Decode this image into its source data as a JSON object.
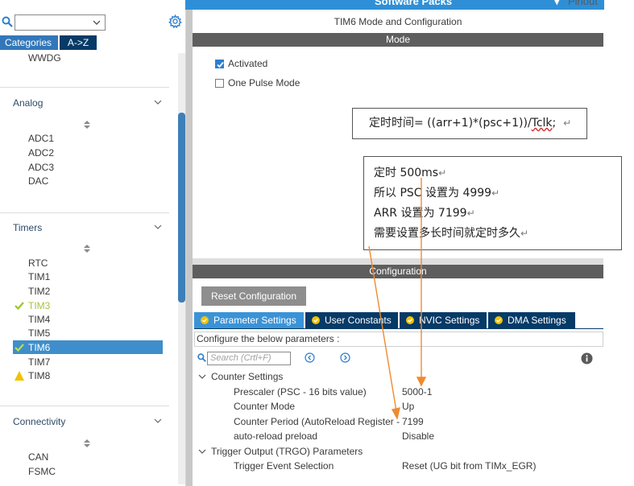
{
  "topbar": {
    "software_packs": "Software Packs",
    "pinout_arrow": "▾",
    "pinout": "Pinout"
  },
  "left_panel": {
    "tabs": {
      "categories": "Categories",
      "az": "A->Z"
    },
    "system_core_items": [
      "WWDG"
    ],
    "analog": {
      "header": "Analog",
      "items": [
        "ADC1",
        "ADC2",
        "ADC3",
        "DAC"
      ]
    },
    "timers": {
      "header": "Timers",
      "items": [
        {
          "label": "RTC",
          "status": "none"
        },
        {
          "label": "TIM1",
          "status": "none"
        },
        {
          "label": "TIM2",
          "status": "none"
        },
        {
          "label": "TIM3",
          "status": "configured"
        },
        {
          "label": "TIM4",
          "status": "none"
        },
        {
          "label": "TIM5",
          "status": "none"
        },
        {
          "label": "TIM6",
          "status": "selected"
        },
        {
          "label": "TIM7",
          "status": "none"
        },
        {
          "label": "TIM8",
          "status": "warning"
        }
      ]
    },
    "connectivity": {
      "header": "Connectivity",
      "items": [
        "CAN",
        "FSMC"
      ]
    }
  },
  "right_panel": {
    "title": "TIM6 Mode and Configuration",
    "mode_header": "Mode",
    "activated": {
      "label": "Activated",
      "checked": true
    },
    "one_pulse": {
      "label": "One Pulse Mode",
      "checked": false
    },
    "config_header": "Configuration",
    "reset_button": "Reset Configuration",
    "tabs": [
      "Parameter Settings",
      "User Constants",
      "NVIC Settings",
      "DMA Settings"
    ],
    "active_tab": "Parameter Settings",
    "configure_label": "Configure the below parameters :",
    "search_placeholder": "Search (Crtl+F)",
    "groups": {
      "counter_settings": {
        "label": "Counter Settings",
        "params": [
          {
            "name": "Prescaler (PSC - 16 bits value)",
            "value": "5000-1"
          },
          {
            "name": "Counter Mode",
            "value": "Up"
          },
          {
            "name": "Counter Period (AutoReload Register - ...",
            "value": "7199"
          },
          {
            "name": "auto-reload preload",
            "value": "Disable"
          }
        ]
      },
      "trigger_output": {
        "label": "Trigger Output (TRGO) Parameters",
        "params": [
          {
            "name": "Trigger Event Selection",
            "value": "Reset (UG bit from TIMx_EGR)"
          }
        ]
      }
    }
  },
  "annotations": {
    "formula": {
      "prefix": "定时时间= ((arr+1)*(psc+1))/",
      "squiggle": "Tclk",
      "suffix": ";",
      "ret": "↵"
    },
    "note_lines": [
      "定时 500ms",
      "所以 PSC 设置为 4999",
      "ARR 设置为 7199",
      "需要设置多长时间就定时多久"
    ],
    "ret": "↵"
  },
  "colors": {
    "accent_blue": "#3a93d7",
    "dark_navy": "#063a67",
    "arrow_orange": "#f08a30",
    "warning_yellow": "#f2c200",
    "check_green": "#9cc32a"
  }
}
